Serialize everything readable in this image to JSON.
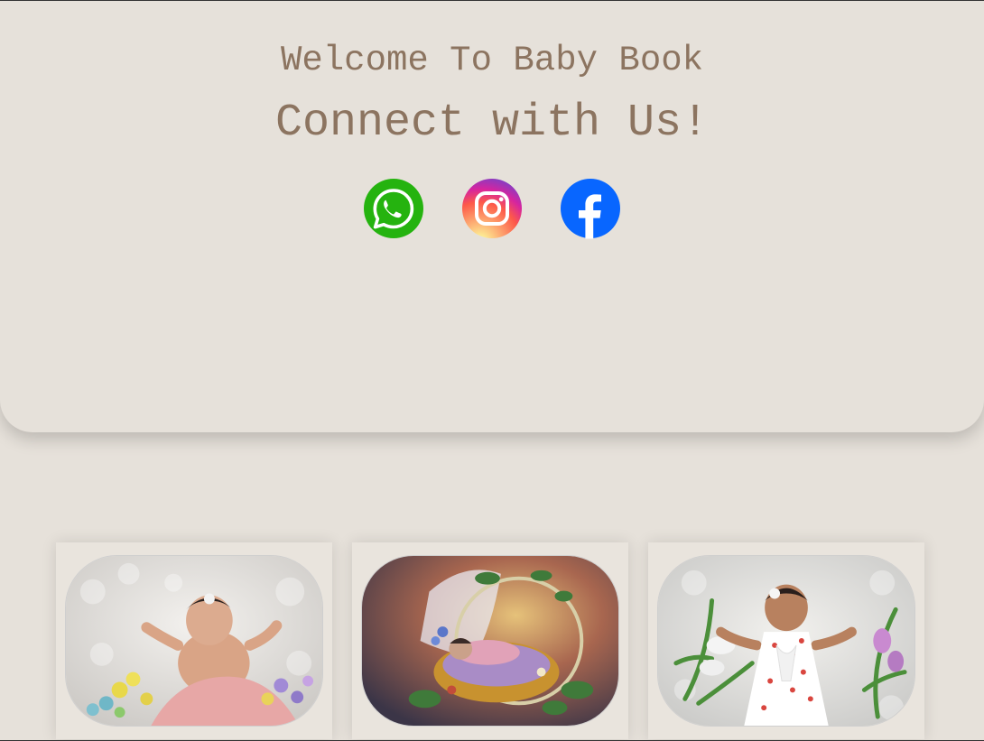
{
  "header": {
    "welcome": "Welcome To Baby Book",
    "connect": "Connect with Us!"
  },
  "socials": [
    {
      "name": "whatsapp",
      "icon": "whatsapp-icon",
      "color": "#25b30f"
    },
    {
      "name": "instagram",
      "icon": "instagram-icon",
      "color": "#d6306f"
    },
    {
      "name": "facebook",
      "icon": "facebook-icon",
      "color": "#0866ff"
    }
  ],
  "colors": {
    "background": "#e6e1da",
    "heading": "#8c7460"
  },
  "gallery": [
    {
      "subject": "baby-on-white-fur-with-flowers"
    },
    {
      "subject": "baby-in-floral-basket"
    },
    {
      "subject": "baby-in-heart-dress-with-lilies"
    }
  ]
}
